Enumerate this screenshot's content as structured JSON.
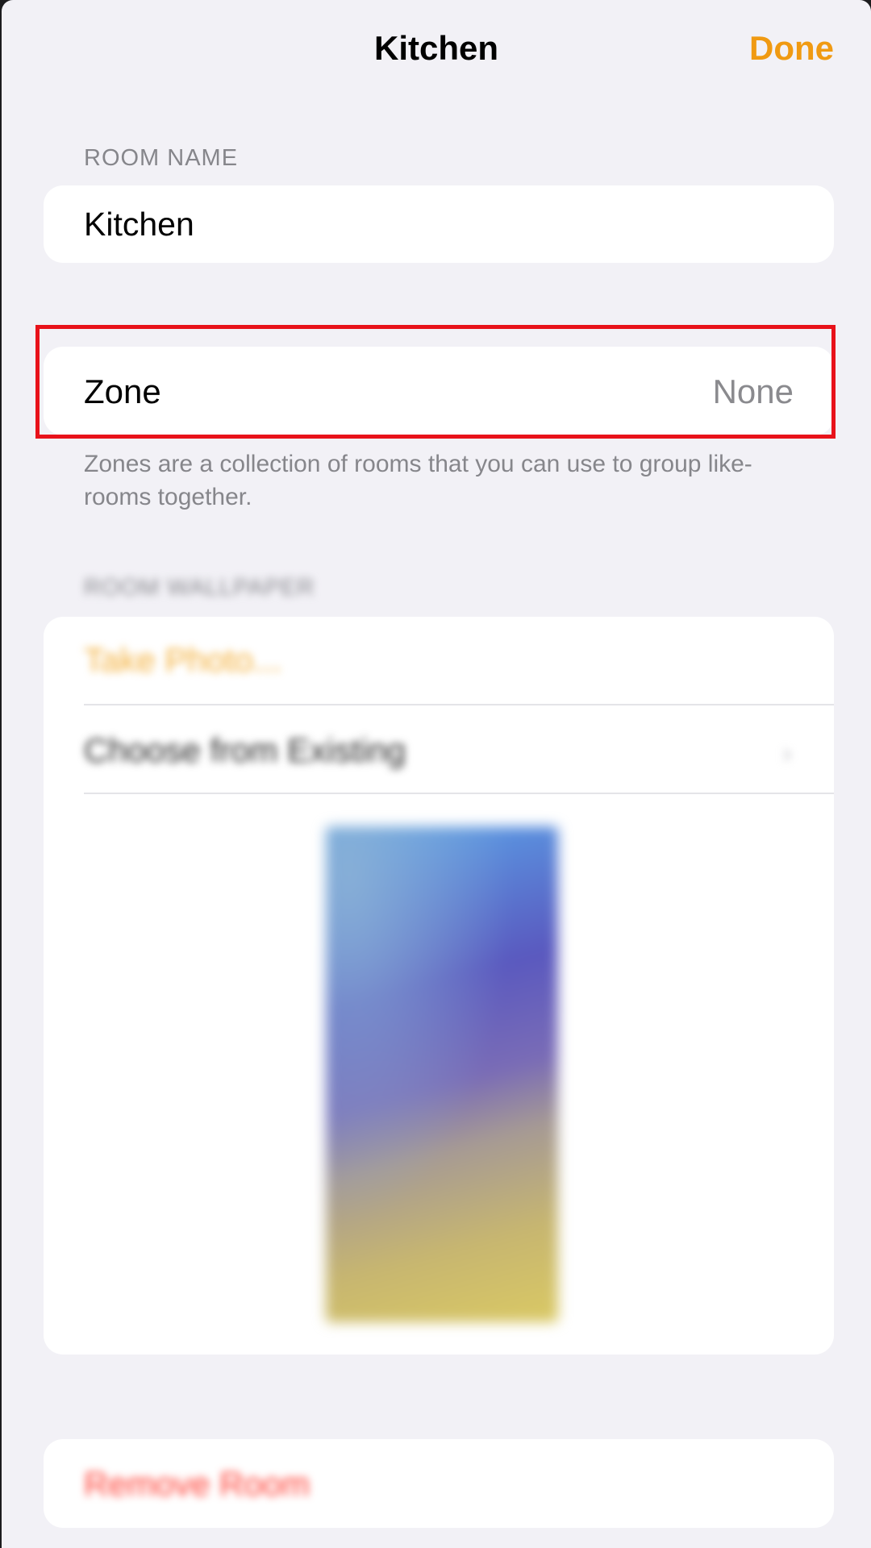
{
  "nav": {
    "title": "Kitchen",
    "done_label": "Done"
  },
  "room_name": {
    "header": "ROOM NAME",
    "value": "Kitchen"
  },
  "zone": {
    "label": "Zone",
    "value": "None",
    "footer": "Zones are a collection of rooms that you can use to group like-rooms together."
  },
  "wallpaper": {
    "header": "ROOM WALLPAPER",
    "take_photo_label": "Take Photo...",
    "choose_existing_label": "Choose from Existing",
    "chevron_icon": "chevron-right-icon"
  },
  "remove": {
    "label": "Remove Room"
  },
  "colors": {
    "accent": "#f09a12",
    "destructive": "#ff3b30",
    "background": "#f2f1f6",
    "highlight": "#e8121a"
  }
}
